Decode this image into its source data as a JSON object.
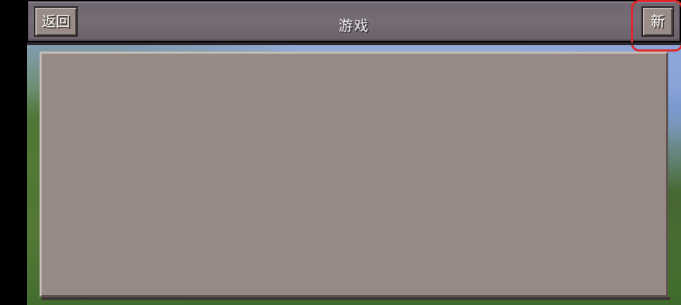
{
  "header": {
    "title": "游戏",
    "back_label": "返回",
    "new_label": "新"
  },
  "colors": {
    "header_bg": "#766c76",
    "button_bg": "#9a8c86",
    "panel_bg": "#978983",
    "highlight": "#e0282c"
  },
  "world_list": {
    "items": []
  }
}
